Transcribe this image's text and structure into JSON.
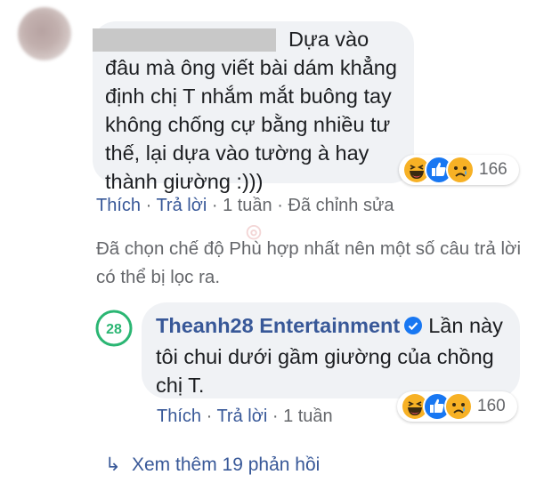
{
  "comment1": {
    "line1": "Dựa vào",
    "rest": "đâu mà ông viết bài dám khẳng định chị T nhắm mắt buông tay không chống cự bằng nhiều tư thế, lại dựa vào tường à hay thành giường :)))",
    "reaction_count": "166",
    "reactions": [
      "haha-icon",
      "like-icon",
      "sad-icon"
    ]
  },
  "actions1": {
    "like": "Thích",
    "reply": "Trả lời",
    "time": "1 tuần",
    "edited": "Đã chỉnh sửa",
    "sep": " · "
  },
  "filter_note": "Đã chọn chế độ Phù hợp nhất nên một số câu trả lời có thể bị lọc ra.",
  "reply": {
    "author": "Theanh28 Entertainment",
    "logo_text": "28",
    "text": "Lần này tôi chui dưới gầm giường của chồng chị T.",
    "reaction_count": "160"
  },
  "actions2": {
    "like": "Thích",
    "reply": "Trả lời",
    "time": "1 tuần",
    "sep": " · "
  },
  "see_more": "Xem thêm 19 phản hồi",
  "colors": {
    "link": "#385898",
    "meta": "#65676b",
    "bubble": "#f0f2f5",
    "like_blue": "#1877f2",
    "emoji_yellow": "#f7b125",
    "brand_green": "#2bb673"
  }
}
